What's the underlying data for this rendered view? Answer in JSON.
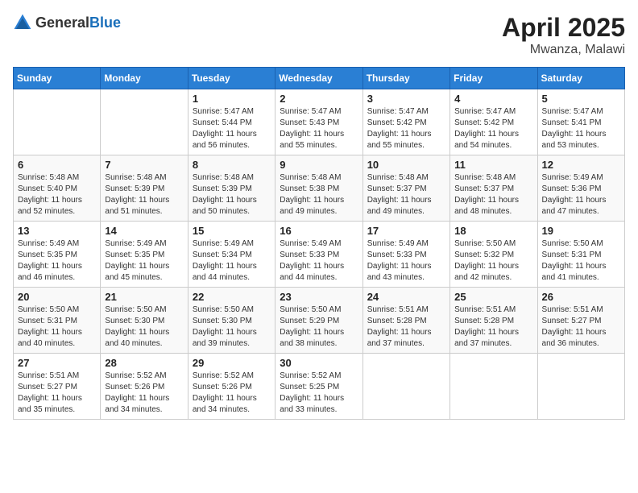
{
  "header": {
    "logo_general": "General",
    "logo_blue": "Blue",
    "month": "April 2025",
    "location": "Mwanza, Malawi"
  },
  "days_of_week": [
    "Sunday",
    "Monday",
    "Tuesday",
    "Wednesday",
    "Thursday",
    "Friday",
    "Saturday"
  ],
  "weeks": [
    [
      {
        "day": "",
        "info": ""
      },
      {
        "day": "",
        "info": ""
      },
      {
        "day": "1",
        "info": "Sunrise: 5:47 AM\nSunset: 5:44 PM\nDaylight: 11 hours and 56 minutes."
      },
      {
        "day": "2",
        "info": "Sunrise: 5:47 AM\nSunset: 5:43 PM\nDaylight: 11 hours and 55 minutes."
      },
      {
        "day": "3",
        "info": "Sunrise: 5:47 AM\nSunset: 5:42 PM\nDaylight: 11 hours and 55 minutes."
      },
      {
        "day": "4",
        "info": "Sunrise: 5:47 AM\nSunset: 5:42 PM\nDaylight: 11 hours and 54 minutes."
      },
      {
        "day": "5",
        "info": "Sunrise: 5:47 AM\nSunset: 5:41 PM\nDaylight: 11 hours and 53 minutes."
      }
    ],
    [
      {
        "day": "6",
        "info": "Sunrise: 5:48 AM\nSunset: 5:40 PM\nDaylight: 11 hours and 52 minutes."
      },
      {
        "day": "7",
        "info": "Sunrise: 5:48 AM\nSunset: 5:39 PM\nDaylight: 11 hours and 51 minutes."
      },
      {
        "day": "8",
        "info": "Sunrise: 5:48 AM\nSunset: 5:39 PM\nDaylight: 11 hours and 50 minutes."
      },
      {
        "day": "9",
        "info": "Sunrise: 5:48 AM\nSunset: 5:38 PM\nDaylight: 11 hours and 49 minutes."
      },
      {
        "day": "10",
        "info": "Sunrise: 5:48 AM\nSunset: 5:37 PM\nDaylight: 11 hours and 49 minutes."
      },
      {
        "day": "11",
        "info": "Sunrise: 5:48 AM\nSunset: 5:37 PM\nDaylight: 11 hours and 48 minutes."
      },
      {
        "day": "12",
        "info": "Sunrise: 5:49 AM\nSunset: 5:36 PM\nDaylight: 11 hours and 47 minutes."
      }
    ],
    [
      {
        "day": "13",
        "info": "Sunrise: 5:49 AM\nSunset: 5:35 PM\nDaylight: 11 hours and 46 minutes."
      },
      {
        "day": "14",
        "info": "Sunrise: 5:49 AM\nSunset: 5:35 PM\nDaylight: 11 hours and 45 minutes."
      },
      {
        "day": "15",
        "info": "Sunrise: 5:49 AM\nSunset: 5:34 PM\nDaylight: 11 hours and 44 minutes."
      },
      {
        "day": "16",
        "info": "Sunrise: 5:49 AM\nSunset: 5:33 PM\nDaylight: 11 hours and 44 minutes."
      },
      {
        "day": "17",
        "info": "Sunrise: 5:49 AM\nSunset: 5:33 PM\nDaylight: 11 hours and 43 minutes."
      },
      {
        "day": "18",
        "info": "Sunrise: 5:50 AM\nSunset: 5:32 PM\nDaylight: 11 hours and 42 minutes."
      },
      {
        "day": "19",
        "info": "Sunrise: 5:50 AM\nSunset: 5:31 PM\nDaylight: 11 hours and 41 minutes."
      }
    ],
    [
      {
        "day": "20",
        "info": "Sunrise: 5:50 AM\nSunset: 5:31 PM\nDaylight: 11 hours and 40 minutes."
      },
      {
        "day": "21",
        "info": "Sunrise: 5:50 AM\nSunset: 5:30 PM\nDaylight: 11 hours and 40 minutes."
      },
      {
        "day": "22",
        "info": "Sunrise: 5:50 AM\nSunset: 5:30 PM\nDaylight: 11 hours and 39 minutes."
      },
      {
        "day": "23",
        "info": "Sunrise: 5:50 AM\nSunset: 5:29 PM\nDaylight: 11 hours and 38 minutes."
      },
      {
        "day": "24",
        "info": "Sunrise: 5:51 AM\nSunset: 5:28 PM\nDaylight: 11 hours and 37 minutes."
      },
      {
        "day": "25",
        "info": "Sunrise: 5:51 AM\nSunset: 5:28 PM\nDaylight: 11 hours and 37 minutes."
      },
      {
        "day": "26",
        "info": "Sunrise: 5:51 AM\nSunset: 5:27 PM\nDaylight: 11 hours and 36 minutes."
      }
    ],
    [
      {
        "day": "27",
        "info": "Sunrise: 5:51 AM\nSunset: 5:27 PM\nDaylight: 11 hours and 35 minutes."
      },
      {
        "day": "28",
        "info": "Sunrise: 5:52 AM\nSunset: 5:26 PM\nDaylight: 11 hours and 34 minutes."
      },
      {
        "day": "29",
        "info": "Sunrise: 5:52 AM\nSunset: 5:26 PM\nDaylight: 11 hours and 34 minutes."
      },
      {
        "day": "30",
        "info": "Sunrise: 5:52 AM\nSunset: 5:25 PM\nDaylight: 11 hours and 33 minutes."
      },
      {
        "day": "",
        "info": ""
      },
      {
        "day": "",
        "info": ""
      },
      {
        "day": "",
        "info": ""
      }
    ]
  ]
}
